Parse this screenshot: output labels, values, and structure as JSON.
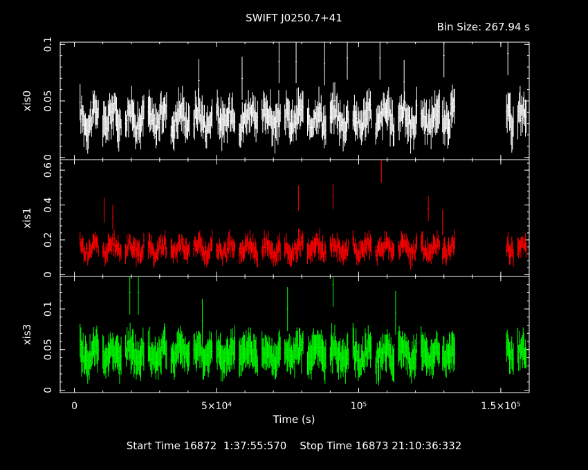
{
  "title": "SWIFT J0250.7+41",
  "bin_size_label": "Bin Size: 267.94 s",
  "xlabel": "Time (s)",
  "start_time": "Start Time 16872  1:37:55:570",
  "stop_time": "Stop Time 16873 21:10:36:332",
  "colors": {
    "xis0": "#ffffff",
    "xis1": "#ff0000",
    "xis3": "#00ff00",
    "frame": "#ffffff",
    "background": "#000000"
  },
  "chart_data": {
    "type": "scatter",
    "xlim": [
      -5000,
      160000
    ],
    "x_ticks": [
      {
        "value": 0,
        "label": "0"
      },
      {
        "value": 50000,
        "label": "5×10⁴"
      },
      {
        "value": 100000,
        "label": "10⁵"
      },
      {
        "value": 150000,
        "label": "1.5×10⁵"
      }
    ],
    "panels": [
      {
        "name": "xis0",
        "ylabel": "xis0",
        "ylim": [
          -0.002,
          0.102
        ],
        "y_ticks": [
          {
            "value": 0,
            "label": "0"
          },
          {
            "value": 0.05,
            "label": "0.05"
          },
          {
            "value": 0.1,
            "label": "0.1"
          }
        ],
        "typical_rate": 0.035,
        "spread": 0.012,
        "typical_error": 0.012,
        "segments": [
          [
            2000,
            8500
          ],
          [
            10000,
            16500
          ],
          [
            18000,
            24500
          ],
          [
            26000,
            32500
          ],
          [
            34000,
            40500
          ],
          [
            42000,
            48500
          ],
          [
            50000,
            56500
          ],
          [
            58000,
            64500
          ],
          [
            66000,
            72500
          ],
          [
            74000,
            80500
          ],
          [
            82000,
            88500
          ],
          [
            90000,
            96500
          ],
          [
            98000,
            104500
          ],
          [
            106000,
            112500
          ],
          [
            114000,
            120500
          ],
          [
            122000,
            128500
          ],
          [
            129500,
            134000
          ],
          [
            152000,
            154500
          ],
          [
            156000,
            159000
          ]
        ],
        "spikes": [
          [
            43800,
            0.068
          ],
          [
            59000,
            0.07
          ],
          [
            72000,
            0.085
          ],
          [
            78000,
            0.085
          ],
          [
            88000,
            0.083
          ],
          [
            96000,
            0.088
          ],
          [
            107500,
            0.088
          ],
          [
            116000,
            0.067
          ],
          [
            130000,
            0.09
          ],
          [
            152500,
            0.092
          ]
        ]
      },
      {
        "name": "xis1",
        "ylabel": "xis1",
        "ylim": [
          -0.01,
          0.66
        ],
        "y_ticks": [
          {
            "value": 0,
            "label": "0"
          },
          {
            "value": 0.2,
            "label": "0.2"
          },
          {
            "value": 0.4,
            "label": "0.4"
          },
          {
            "value": 0.6,
            "label": "0.6"
          }
        ],
        "typical_rate": 0.15,
        "spread": 0.045,
        "typical_error": 0.045,
        "segments": [
          [
            2000,
            8500
          ],
          [
            10000,
            16500
          ],
          [
            18000,
            24500
          ],
          [
            26000,
            32500
          ],
          [
            34000,
            40500
          ],
          [
            42000,
            48500
          ],
          [
            50000,
            56500
          ],
          [
            58000,
            64500
          ],
          [
            66000,
            72500
          ],
          [
            74000,
            80500
          ],
          [
            82000,
            88500
          ],
          [
            90000,
            96500
          ],
          [
            98000,
            104500
          ],
          [
            106000,
            112500
          ],
          [
            114000,
            120500
          ],
          [
            122000,
            128500
          ],
          [
            129500,
            134000
          ],
          [
            152000,
            154500
          ],
          [
            156000,
            159000
          ]
        ],
        "spikes": [
          [
            10500,
            0.37
          ],
          [
            13500,
            0.33
          ],
          [
            78800,
            0.44
          ],
          [
            91000,
            0.45
          ],
          [
            108000,
            0.6
          ],
          [
            124500,
            0.38
          ],
          [
            129500,
            0.3
          ]
        ]
      },
      {
        "name": "xis3",
        "ylabel": "xis3",
        "ylim": [
          -0.003,
          0.14
        ],
        "y_ticks": [
          {
            "value": 0,
            "label": "0"
          },
          {
            "value": 0.05,
            "label": "0.05"
          },
          {
            "value": 0.1,
            "label": "0.1"
          }
        ],
        "typical_rate": 0.045,
        "spread": 0.013,
        "typical_error": 0.017,
        "segments": [
          [
            2000,
            8500
          ],
          [
            10000,
            16500
          ],
          [
            18000,
            24500
          ],
          [
            26000,
            32500
          ],
          [
            34000,
            40500
          ],
          [
            42000,
            48500
          ],
          [
            50000,
            56500
          ],
          [
            58000,
            64500
          ],
          [
            66000,
            72500
          ],
          [
            74000,
            80500
          ],
          [
            82000,
            88500
          ],
          [
            90000,
            96500
          ],
          [
            98000,
            104500
          ],
          [
            106000,
            112500
          ],
          [
            114000,
            120500
          ],
          [
            122000,
            128500
          ],
          [
            129500,
            134000
          ],
          [
            152000,
            154500
          ],
          [
            156000,
            159000
          ]
        ],
        "spikes": [
          [
            19500,
            0.12
          ],
          [
            22500,
            0.12
          ],
          [
            45000,
            0.085
          ],
          [
            75000,
            0.1
          ],
          [
            91000,
            0.13
          ],
          [
            113000,
            0.095
          ]
        ]
      }
    ]
  }
}
